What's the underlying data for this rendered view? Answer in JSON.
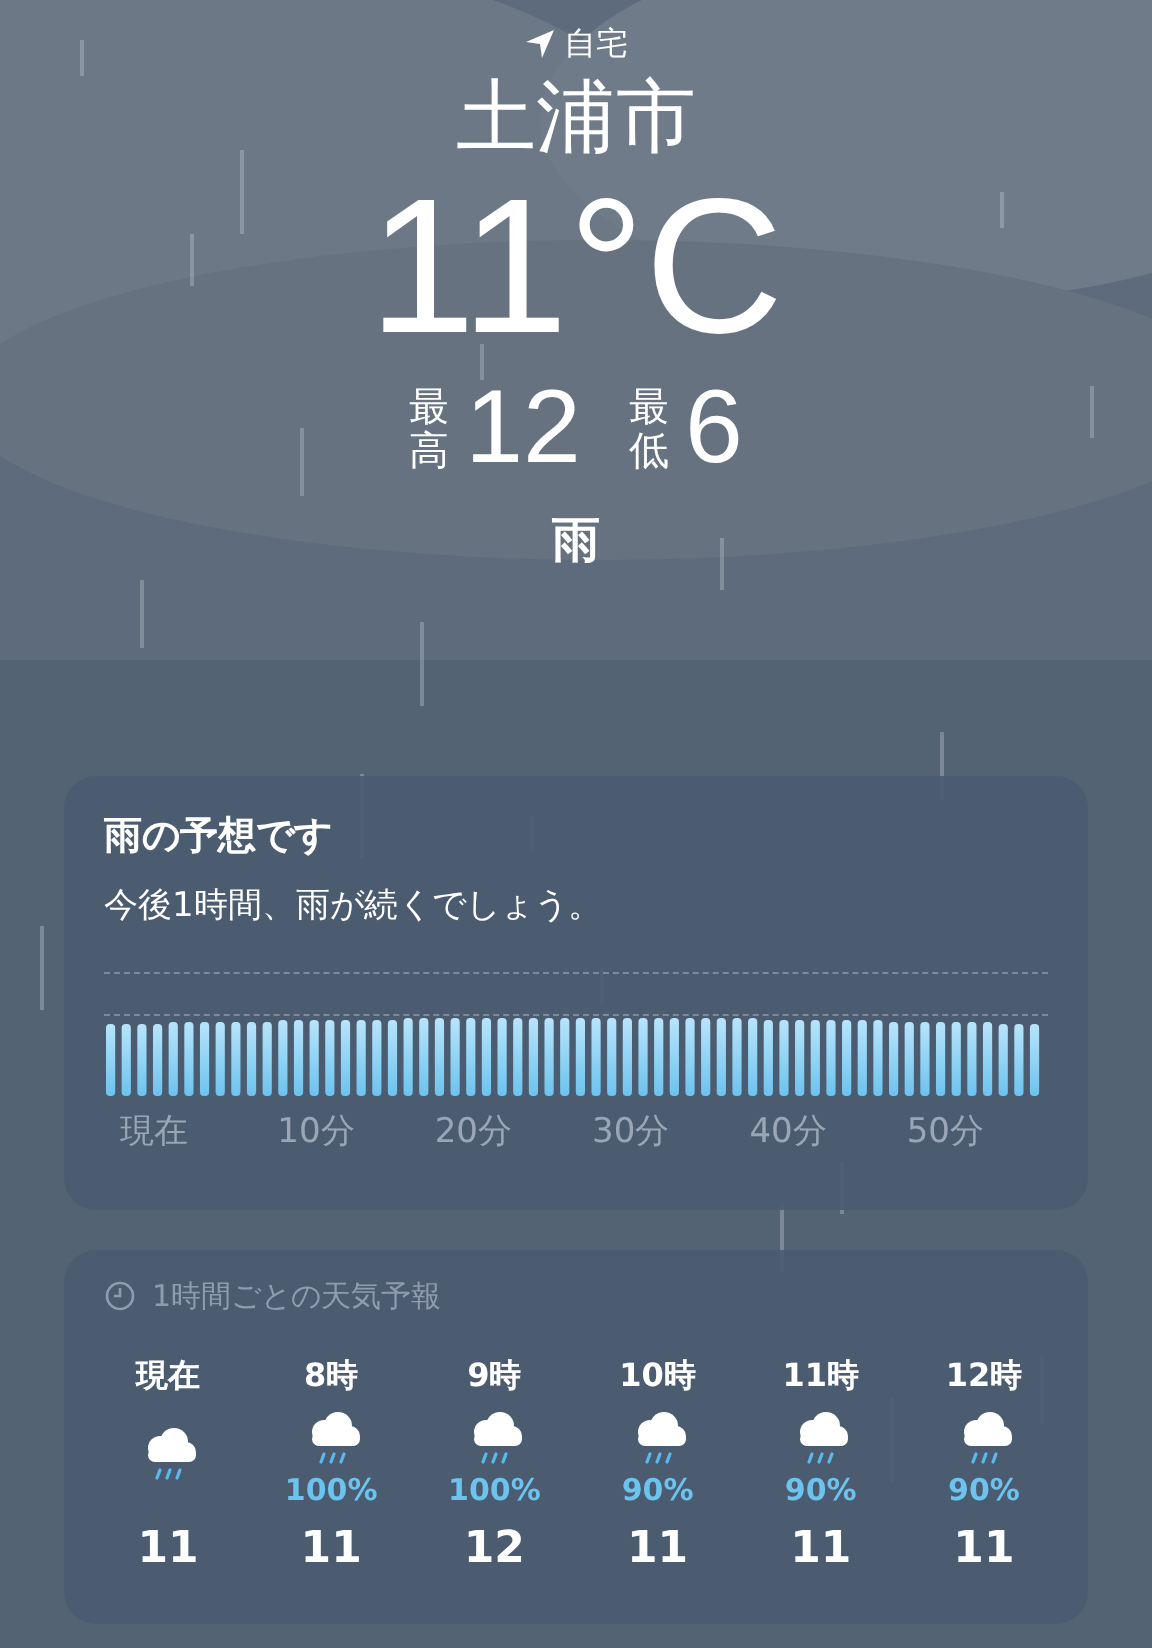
{
  "header": {
    "location_label": "自宅",
    "city": "土浦市",
    "temperature": "11°C",
    "high_label": "最高",
    "high": "12",
    "low_label": "最低",
    "low": "6",
    "condition": "雨"
  },
  "rain_card": {
    "title": "雨の予想です",
    "summary": "今後1時間、雨が続くでしょう。",
    "axis_labels": [
      "現在",
      "10分",
      "20分",
      "30分",
      "40分",
      "50分"
    ]
  },
  "hourly_card": {
    "title": "1時間ごとの天気予報",
    "hours": [
      {
        "time": "現在",
        "temp": "11"
      },
      {
        "time": "8時",
        "chance": "100%",
        "temp": "11"
      },
      {
        "time": "9時",
        "chance": "100%",
        "temp": "12"
      },
      {
        "time": "10時",
        "chance": "90%",
        "temp": "11"
      },
      {
        "time": "11時",
        "chance": "90%",
        "temp": "11"
      },
      {
        "time": "12時",
        "chance": "90%",
        "temp": "11"
      }
    ]
  }
}
